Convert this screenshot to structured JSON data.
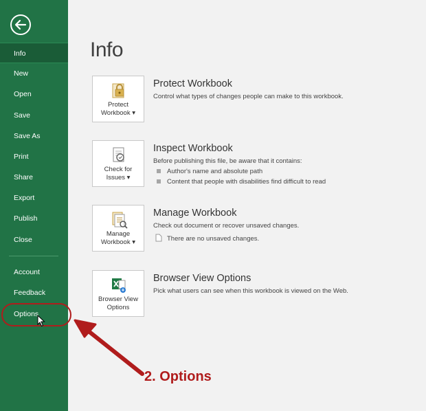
{
  "sidebar": {
    "items": [
      {
        "label": "Info"
      },
      {
        "label": "New"
      },
      {
        "label": "Open"
      },
      {
        "label": "Save"
      },
      {
        "label": "Save As"
      },
      {
        "label": "Print"
      },
      {
        "label": "Share"
      },
      {
        "label": "Export"
      },
      {
        "label": "Publish"
      },
      {
        "label": "Close"
      },
      {
        "label": "Account"
      },
      {
        "label": "Feedback"
      },
      {
        "label": "Options"
      }
    ]
  },
  "main": {
    "title": "Info",
    "sections": [
      {
        "tile_line1": "Protect",
        "tile_line2": "Workbook ▾",
        "title": "Protect Workbook",
        "description": "Control what types of changes people can make to this workbook."
      },
      {
        "tile_line1": "Check for",
        "tile_line2": "Issues ▾",
        "title": "Inspect Workbook",
        "description": "Before publishing this file, be aware that it contains:",
        "bullets": [
          "Author's name and absolute path",
          "Content that people with disabilities find difficult to read"
        ]
      },
      {
        "tile_line1": "Manage",
        "tile_line2": "Workbook ▾",
        "title": "Manage Workbook",
        "description": "Check out document or recover unsaved changes.",
        "note": "There are no unsaved changes."
      },
      {
        "tile_line1": "Browser View",
        "tile_line2": "Options",
        "title": "Browser View Options",
        "description": "Pick what users can see when this workbook is viewed on the Web."
      }
    ]
  },
  "annotation": {
    "label": "2. Options",
    "color": "#b01c1c"
  },
  "colors": {
    "sidebar": "#217346",
    "background": "#f2f2f2"
  }
}
